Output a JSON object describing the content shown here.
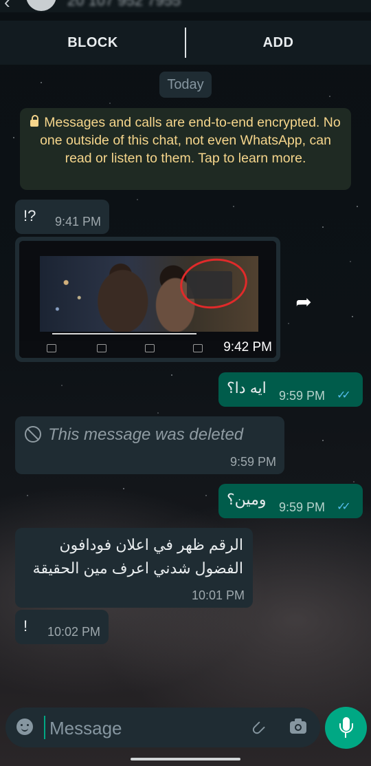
{
  "header": {
    "contact_number": "20 107 952 7955",
    "back_glyph": "‹"
  },
  "actions": {
    "block_label": "BLOCK",
    "add_label": "ADD"
  },
  "date_chip": "Today",
  "encryption_notice": "Messages and calls are end-to-end encrypted. No one outside of this chat, not even WhatsApp, can read or listen to them. Tap to learn more.",
  "messages": [
    {
      "id": "m1",
      "direction": "in",
      "text": "!?",
      "time": "9:41 PM"
    },
    {
      "id": "m2",
      "direction": "in",
      "type": "video",
      "time": "9:42 PM"
    },
    {
      "id": "m3",
      "direction": "out",
      "text": "ايه دا؟",
      "time": "9:59 PM",
      "ticks": "✓✓"
    },
    {
      "id": "m4",
      "direction": "in",
      "type": "deleted",
      "text": "This message was deleted",
      "time": "9:59 PM"
    },
    {
      "id": "m5",
      "direction": "out",
      "text": "ومين؟",
      "time": "9:59 PM",
      "ticks": "✓✓"
    },
    {
      "id": "m6",
      "direction": "in",
      "text_line1": "الرقم ظهر في اعلان فودافون",
      "text_line2": "الفضول شدني اعرف مين الحقيقة",
      "time": "10:01 PM"
    },
    {
      "id": "m7",
      "direction": "in",
      "text": "!",
      "time": "10:02 PM"
    }
  ],
  "composer": {
    "placeholder": "Message"
  },
  "colors": {
    "accent": "#00a884",
    "incoming_bubble": "#1f2c33",
    "outgoing_bubble": "#005c4b",
    "notice_bg": "#1f2a23",
    "notice_text": "#f6d68c",
    "read_ticks": "#53bdeb"
  },
  "icons": [
    "back-arrow-icon",
    "avatar",
    "lock-icon",
    "forward-icon",
    "blocked-icon",
    "emoji-icon",
    "attach-icon",
    "camera-icon",
    "mic-icon"
  ]
}
